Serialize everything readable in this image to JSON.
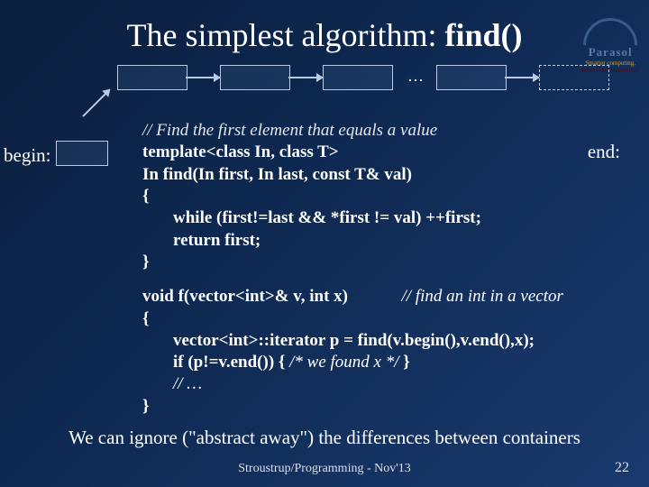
{
  "title": {
    "prefix": "The simplest algorithm: ",
    "fn": "find()"
  },
  "logo": {
    "name": "Parasol",
    "tagline": "Smarter computing.",
    "university": "Texas A&M University"
  },
  "diagram": {
    "ellipsis": "…",
    "begin_label": "begin:",
    "end_label": "end:"
  },
  "code": {
    "comment_top": "// Find the first element that equals a value",
    "l1": "template<class In, class T>",
    "l2": "In find(In first, In last, const T& val)",
    "l3": "{",
    "l4": "while (first!=last && *first != val) ++first;",
    "l5": "return first;",
    "l6": "}",
    "f_sig": "void f(vector<int>& v, int x)",
    "f_comment": "// find an int in a vector",
    "f_open": "{",
    "f_body1": "vector<int>::iterator p = find(v.begin(),v.end(),x);",
    "f_body2_a": "if (p!=v.end()) { ",
    "f_body2_b": "/* we found  x */",
    "f_body2_c": " }",
    "f_body3": "// …",
    "f_close": "}"
  },
  "bottom": "We can ignore (\"abstract away\") the differences between containers",
  "footer": "Stroustrup/Programming - Nov'13",
  "page": "22"
}
